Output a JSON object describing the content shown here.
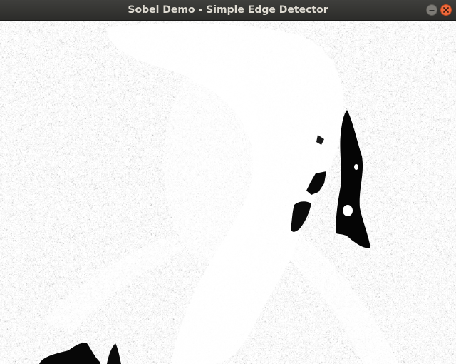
{
  "window": {
    "title": "Sobel Demo - Simple Edge Detector"
  },
  "titlebar_buttons": {
    "minimize_icon": "minimize-icon",
    "close_icon": "close-icon",
    "close_color": "#f06a3c"
  },
  "image": {
    "description_tag": "sobel-edge-output",
    "palette": {
      "background": "#ffffff",
      "edges": "#111111",
      "mid": "#6b6b6b"
    }
  }
}
